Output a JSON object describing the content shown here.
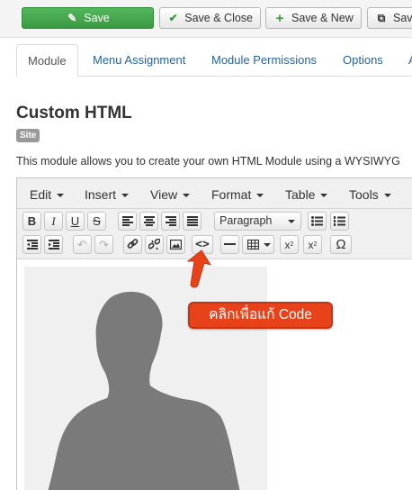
{
  "toolbar": {
    "save": "Save",
    "save_close": "Save & Close",
    "save_new": "Save & New",
    "save_copy": "Sav"
  },
  "tabs": [
    "Module",
    "Menu Assignment",
    "Module Permissions",
    "Options",
    "A"
  ],
  "page": {
    "title": "Custom HTML",
    "badge": "Site",
    "description": "This module allows you to create your own HTML Module using a WYSIWYG"
  },
  "editor": {
    "menus": [
      "Edit",
      "Insert",
      "View",
      "Format",
      "Table",
      "Tools"
    ],
    "format_select": "Paragraph",
    "icons_row1": [
      "bold-icon",
      "italic-icon",
      "underline-icon",
      "strikethrough-icon",
      "align-left-icon",
      "align-center-icon",
      "align-right-icon",
      "align-justify-icon",
      "bullet-list-icon",
      "numbered-list-icon"
    ],
    "icons_row2": [
      "outdent-icon",
      "indent-icon",
      "undo-icon",
      "redo-icon",
      "link-icon",
      "unlink-icon",
      "image-icon",
      "code-icon",
      "horizontal-rule-icon",
      "table-icon",
      "subscript-icon",
      "superscript-icon",
      "special-character-icon"
    ]
  },
  "annotation": {
    "text": "คลิกเพื่อแก้ Code",
    "color": "#e8421a"
  }
}
